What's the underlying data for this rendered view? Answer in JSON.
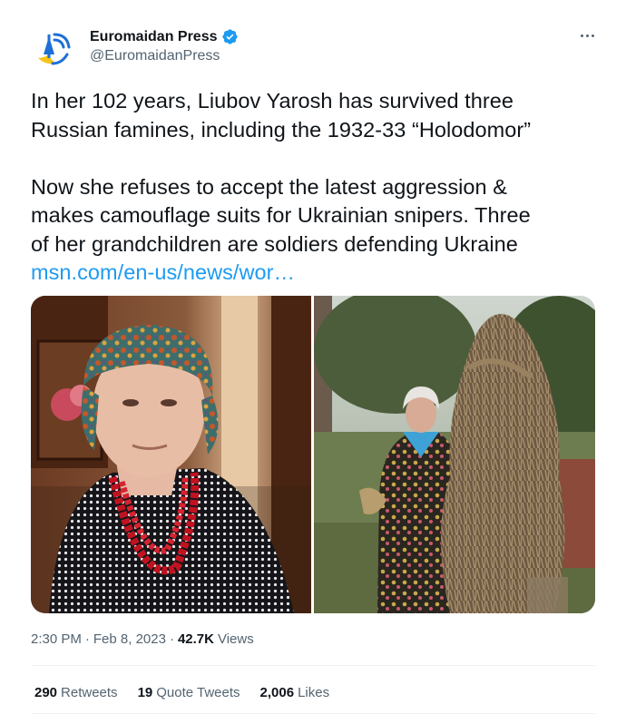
{
  "author": {
    "display_name": "Euromaidan Press",
    "handle": "@EuromaidanPress",
    "verified": true,
    "avatar_icon": "euromaidan-logo-icon"
  },
  "menu": {
    "icon": "more-options-icon"
  },
  "tweet": {
    "paragraph1": [
      "In her 102 years, Liubov Yarosh has survived three",
      "Russian famines, including the 1932-33 “Holodomor”"
    ],
    "paragraph2": [
      "Now she refuses to accept the latest aggression &",
      "makes camouflage suits for Ukrainian snipers. Three",
      "of her grandchildren are soldiers defending Ukraine"
    ],
    "link": "msn.com/en-us/news/wor…"
  },
  "media": {
    "photos": [
      "elderly-woman-portrait-photo",
      "woman-with-ghillie-suit-photo"
    ]
  },
  "meta": {
    "time": "2:30 PM",
    "separator": "·",
    "date": "Feb 8, 2023",
    "views_count": "42.7K",
    "views_label": "Views"
  },
  "stats": {
    "retweets_count": "290",
    "retweets_label": "Retweets",
    "quotes_count": "19",
    "quotes_label": "Quote Tweets",
    "likes_count": "2,006",
    "likes_label": "Likes"
  },
  "colors": {
    "accent": "#1d9bf0",
    "text": "#0f1419",
    "secondary": "#536471",
    "divider": "#eff3f4",
    "logo_blue": "#1d6fd6",
    "logo_yellow": "#f5c518"
  }
}
